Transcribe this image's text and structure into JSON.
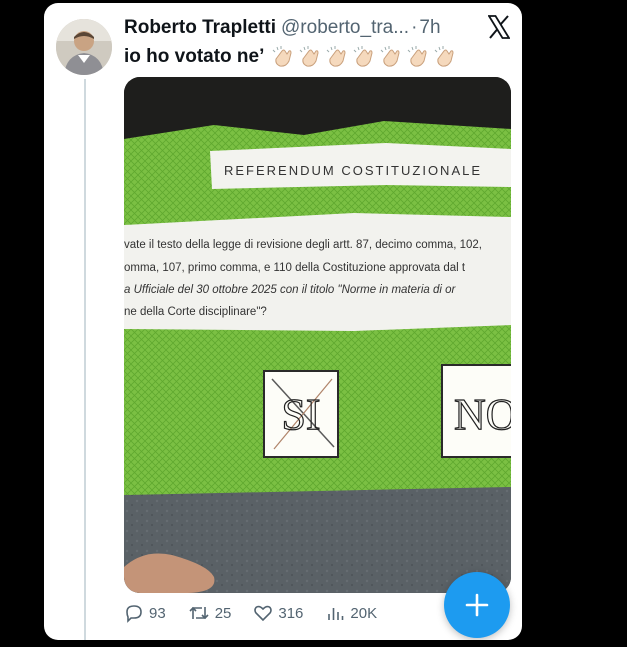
{
  "tweet": {
    "author_name": "Roberto Trapletti",
    "handle": "@roberto_tra...",
    "separator": "·",
    "time": "7h",
    "text": "io ho votato ne’",
    "emoji_count": 7
  },
  "ballot": {
    "heading": "REFERENDUM COSTITUZIONALE",
    "question_lines": [
      "vate il testo della legge di revisione degli artt. 87, decimo comma, 102,",
      "omma, 107, primo comma, e 110 della Costituzione approvata dal t",
      "a Ufficiale del 30 ottobre 2025 con il titolo \"Norme in materia di or",
      "ne della Corte disciplinare\"?"
    ],
    "option_yes": "SI",
    "option_no": "NO"
  },
  "actions": {
    "replies": "93",
    "reposts": "25",
    "likes": "316",
    "views": "20K"
  },
  "fab": {
    "label": "+"
  },
  "colors": {
    "accent": "#1d9bf0",
    "text": "#0f1419",
    "secondary": "#536471",
    "ballot_green": "#7bc043"
  },
  "icons": [
    "x-logo-icon",
    "clap-icon",
    "reply-icon",
    "repost-icon",
    "like-icon",
    "views-icon",
    "plus-icon"
  ]
}
